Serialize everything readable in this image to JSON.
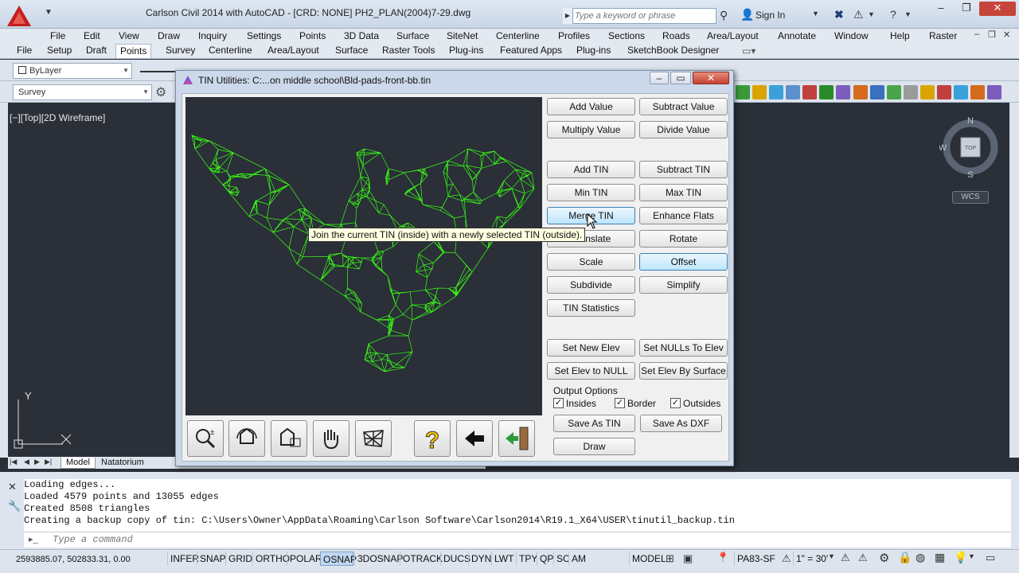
{
  "window": {
    "title": "Carlson Civil 2014 with AutoCAD - [CRD: NONE]      PH2_PLAN(2004)7-29.dwg",
    "search_placeholder": "Type a keyword or phrase",
    "sign_in": "Sign In"
  },
  "menubar": [
    "File",
    "Edit",
    "View",
    "Draw",
    "Inquiry",
    "Settings",
    "Points",
    "3D Data",
    "Surface",
    "SiteNet",
    "Centerline",
    "Profiles",
    "Sections",
    "Roads",
    "Area/Layout",
    "Annotate",
    "Window",
    "Help",
    "Raster"
  ],
  "ribbon_tabs": [
    "File",
    "Setup",
    "Draft",
    "Points",
    "Survey",
    "Centerline",
    "Area/Layout",
    "Surface",
    "Raster Tools",
    "Plug-ins",
    "Featured Apps",
    "Plug-ins",
    "SketchBook Designer"
  ],
  "ribbon_active": "Points",
  "toolbars": {
    "layer_combo": "ByLayer",
    "workspace_combo": "Survey"
  },
  "viewport": {
    "label": "[−][Top][2D Wireframe]",
    "compass": {
      "n": "N",
      "s": "S",
      "w": "W",
      "cube": "TOP"
    },
    "wcs": "WCS",
    "ucs_y": "Y"
  },
  "layout_tabs": [
    "Model",
    "Natatorium"
  ],
  "dialog": {
    "title": "TIN Utilities: C:...on middle school\\Bld-pads-front-bb.tin",
    "buttons": {
      "add_value": "Add Value",
      "subtract_value": "Subtract Value",
      "multiply_value": "Multiply Value",
      "divide_value": "Divide Value",
      "add_tin": "Add TIN",
      "subtract_tin": "Subtract TIN",
      "min_tin": "Min TIN",
      "max_tin": "Max TIN",
      "merge_tin": "Merge TIN",
      "enhance_flats": "Enhance Flats",
      "translate": "Translate",
      "rotate": "Rotate",
      "scale": "Scale",
      "offset": "Offset",
      "subdivide": "Subdivide",
      "simplify": "Simplify",
      "tin_statistics": "TIN Statistics",
      "set_new_elev": "Set New Elev",
      "set_nulls_to_elev": "Set NULLs To Elev",
      "set_elev_to_null": "Set Elev to NULL",
      "set_elev_by_surface": "Set Elev By Surface",
      "save_as_tin": "Save As TIN",
      "save_as_dxf": "Save As DXF",
      "draw": "Draw"
    },
    "output_options": {
      "label": "Output Options",
      "insides": "Insides",
      "border": "Border",
      "outsides": "Outsides",
      "insides_checked": true,
      "border_checked": true,
      "outsides_checked": true
    },
    "tooltip": "Join the current TIN (inside) with a newly selected TIN (outside).",
    "icon_buttons": [
      "zoom-icon",
      "zoom-extents-icon",
      "zoom-window-icon",
      "pan-hand-icon",
      "mesh-icon",
      "help-icon",
      "back-arrow-icon",
      "exit-icon"
    ]
  },
  "command_history": [
    "Loading edges...",
    "Loaded 4579 points and 13055 edges",
    "Created 8508 triangles",
    "Creating a backup copy of tin: C:\\Users\\Owner\\AppData\\Roaming\\Carlson Software\\Carlson2014\\R19.1_X64\\USER\\tinutil_backup.tin"
  ],
  "command_placeholder": "Type a command",
  "statusbar": {
    "coords": "2593885.07, 502833.31, 0.00",
    "toggles": [
      "INFER",
      "SNAP",
      "GRID",
      "ORTHO",
      "POLAR",
      "OSNAP",
      "3DOSNAP",
      "OTRACK",
      "DUCS",
      "DYN",
      "LWT",
      "TPY",
      "QP",
      "SC",
      "AM"
    ],
    "active_toggle": "OSNAP",
    "model": "MODEL",
    "coord_sys": "PA83-SF",
    "scale": "1\" = 30'"
  },
  "colors": {
    "mesh": "#39ff14",
    "drawing_bg": "#2a2f38",
    "dialog_bg": "#f0f0f0"
  }
}
